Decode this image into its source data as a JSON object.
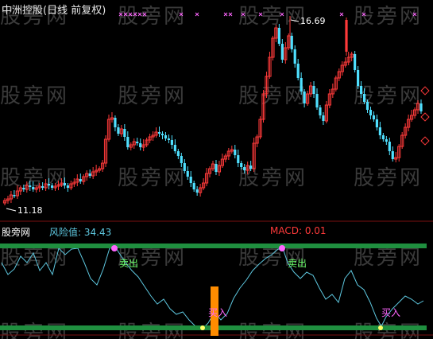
{
  "header": {
    "title": "中洲控股(日线 前复权)"
  },
  "watermark": {
    "text": "股旁网"
  },
  "price_panel": {
    "high_label": "16.69",
    "low_label": "11.18"
  },
  "indicator_panel": {
    "source_label": "股旁网",
    "risk_label": "风险值: 34.43",
    "macd_label": "MACD: 0.01",
    "sell_labels": [
      "卖出",
      "卖出"
    ],
    "buy_labels": [
      "买入",
      "买入"
    ]
  },
  "colors": {
    "up": "#ff3a3a",
    "down": "#4fe0ff",
    "band": "#1f8f3f",
    "bar": "#ff8c00",
    "line": "#5ec8e0",
    "signal": "#ff66ff",
    "sell_text": "#6cff6c",
    "risk_text": "#5ec8e0",
    "macd_text": "#ff3a3a"
  }
}
